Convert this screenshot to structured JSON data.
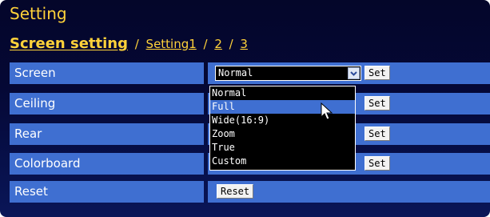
{
  "header": {
    "title": "Setting",
    "crumb_current": "Screen setting",
    "sep": "/",
    "crumb_link1": "Setting1",
    "crumb_link2": "2",
    "crumb_link3": "3"
  },
  "rows": [
    {
      "label": "Screen",
      "button": "Set"
    },
    {
      "label": "Ceiling",
      "button": "Set"
    },
    {
      "label": "Rear",
      "button": "Set"
    },
    {
      "label": "Colorboard",
      "button": "Set"
    },
    {
      "label": "Reset",
      "button": "Reset"
    }
  ],
  "screen_select": {
    "value": "Normal",
    "options": [
      "Normal",
      "Full",
      "Wide(16:9)",
      "Zoom",
      "True",
      "Custom"
    ],
    "highlighted": "Full"
  },
  "colors": {
    "title": "#ffd23a",
    "row_bg": "#3f6fd1",
    "page_bg": "#04062a"
  }
}
